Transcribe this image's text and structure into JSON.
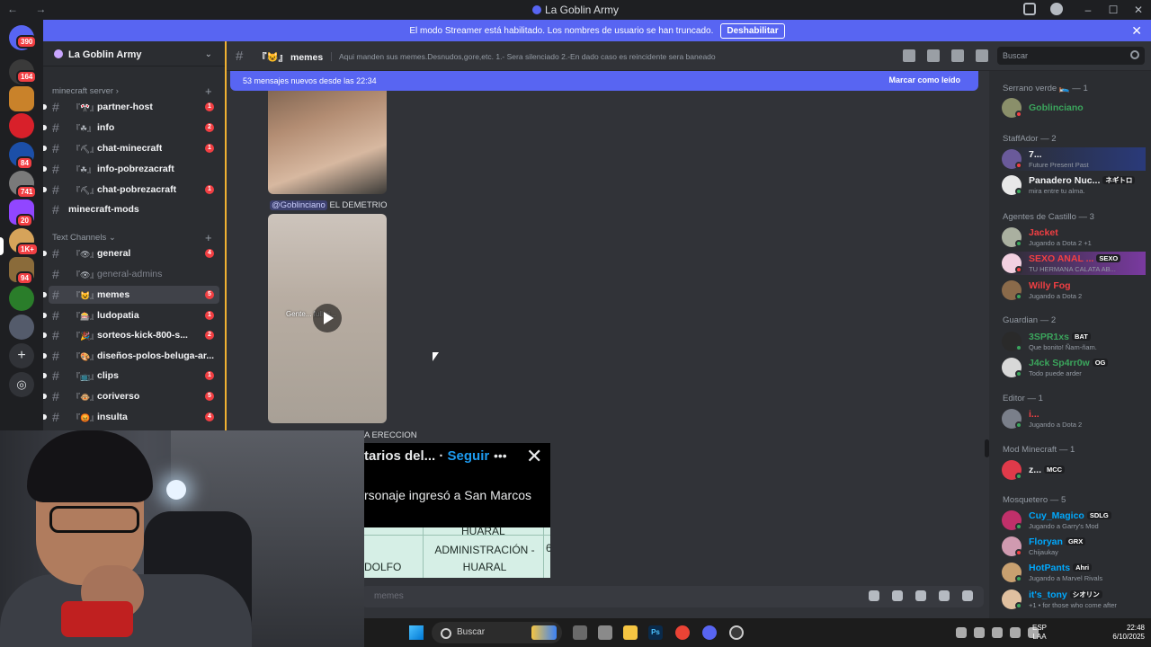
{
  "window": {
    "title": "La Goblin Army"
  },
  "banner": {
    "text": "El modo Streamer está habilitado. Los nombres de usuario se han truncado.",
    "button": "Deshabilitar"
  },
  "rail": {
    "badges": [
      "390",
      "164",
      "84",
      "741",
      "20",
      "1K+",
      "94"
    ]
  },
  "guild": {
    "name": "La Goblin Army"
  },
  "categories": {
    "minecraft": "minecraft server",
    "text": "Text Channels"
  },
  "channels": [
    {
      "emoji": "『🎌』",
      "name": "partner-host",
      "unread": "1"
    },
    {
      "emoji": "『☘』",
      "name": "info",
      "unread": "2"
    },
    {
      "emoji": "『⛏』",
      "name": "chat-minecraft",
      "unread": "1"
    },
    {
      "emoji": "『☘』",
      "name": "info-pobrezacraft",
      "unread": ""
    },
    {
      "emoji": "『⛏』",
      "name": "chat-pobrezacraft",
      "unread": "1"
    },
    {
      "emoji": "",
      "name": "minecraft-mods",
      "unread": ""
    },
    {
      "emoji": "『👁』",
      "name": "general",
      "unread": "4"
    },
    {
      "emoji": "『👁』",
      "name": "general-admins",
      "unread": ""
    },
    {
      "emoji": "『😺』",
      "name": "memes",
      "unread": "5"
    },
    {
      "emoji": "『🎰』",
      "name": "ludopatia",
      "unread": "1"
    },
    {
      "emoji": "『🎉』",
      "name": "sorteos-kick-800-s...",
      "unread": "2"
    },
    {
      "emoji": "『🎨』",
      "name": "diseños-polos-beluga-ar...",
      "unread": ""
    },
    {
      "emoji": "『📺』",
      "name": "clips",
      "unread": "1"
    },
    {
      "emoji": "『🐵』",
      "name": "coriverso",
      "unread": "5"
    },
    {
      "emoji": "『😡』",
      "name": "insulta",
      "unread": "4"
    }
  ],
  "header": {
    "channel": "『😺』 memes",
    "topic": "Aqui manden sus memes.Desnudos,gore,etc. 1.- Sera silenciado 2.-En dado caso es reincidente sera baneado",
    "search_placeholder": "Buscar"
  },
  "newbar": {
    "text": "53 mensajes nuevos desde las 22:34",
    "action": "Marcar como leído"
  },
  "messages": {
    "mention": "@Goblinciano",
    "text": "EL DEMETRIO",
    "video_caption": "Gente... full ci...",
    "partial_line": "A ERECCION"
  },
  "composer": {
    "placeholder": "memes"
  },
  "members": {
    "groups": [
      {
        "title": "Serrano verde 🛌 — 1",
        "items": [
          {
            "name": "Goblinciano",
            "sub": "",
            "tag": "",
            "color": "#3ba55c"
          }
        ]
      },
      {
        "title": "StaffAdor — 2",
        "items": [
          {
            "name": "7...",
            "sub": "Future Present Past",
            "tag": "",
            "color": "#f2f3f5"
          },
          {
            "name": "Panadero Nuc...",
            "sub": "mira entre tu alma.",
            "tag": "ネギトロ",
            "color": "#f2f3f5"
          }
        ]
      },
      {
        "title": "Agentes de Castillo — 3",
        "items": [
          {
            "name": "Jacket",
            "sub": "Jugando a Dota 2 +1",
            "tag": "",
            "color": "#f23f43"
          },
          {
            "name": "SEXO ANAL ...",
            "sub": "TU HERMANA CALATA AB...",
            "tag": "SEXO",
            "color": "#f23f43"
          },
          {
            "name": "Willy Fog",
            "sub": "Jugando a Dota 2",
            "tag": "",
            "color": "#f23f43"
          }
        ]
      },
      {
        "title": "Guardian — 2",
        "items": [
          {
            "name": "3SPR1xs",
            "sub": "Que bonito! Ñam-ñam.",
            "tag": "BAT",
            "color": "#3ba55c"
          },
          {
            "name": "J4ck Sp4rr0w",
            "sub": "Todo puede arder",
            "tag": "OG",
            "color": "#3ba55c"
          }
        ]
      },
      {
        "title": "Editor — 1",
        "items": [
          {
            "name": "i...",
            "sub": "Jugando a Dota 2",
            "tag": "",
            "color": "#f23f43"
          }
        ]
      },
      {
        "title": "Mod Minecraft — 1",
        "items": [
          {
            "name": "z...",
            "sub": "",
            "tag": "MCC",
            "color": "#f2f3f5"
          }
        ]
      },
      {
        "title": "Mosquetero — 5",
        "items": [
          {
            "name": "Cuy_Magico",
            "sub": "Jugando a Garry's Mod",
            "tag": "SDLG",
            "color": "#00a8fc"
          },
          {
            "name": "Floryan",
            "sub": "Chijaukay",
            "tag": "GRX",
            "color": "#00a8fc"
          },
          {
            "name": "HotPants",
            "sub": "Jugando a Marvel Rivals",
            "tag": "Ahri",
            "color": "#00a8fc"
          },
          {
            "name": "it's_tony",
            "sub": "+1 • for those who come after",
            "tag": "シオリン",
            "color": "#00a8fc"
          }
        ]
      }
    ]
  },
  "tweet": {
    "head": "tarios del...",
    "follow": "Seguir",
    "body": "rsonaje ingresó a San Marcos",
    "doc_top": "HUARAL",
    "doc_left": "DOLFO",
    "doc_mid": "ADMINISTRACIÓN - HUARAL",
    "doc_right": "6"
  },
  "taskbar": {
    "search": "Buscar",
    "lang1": "ESP",
    "lang2": "LAA",
    "time": "22:48",
    "date": "6/10/2025"
  }
}
